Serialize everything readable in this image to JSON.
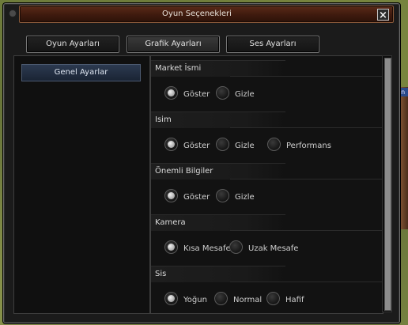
{
  "window": {
    "title": "Oyun Seçenekleri",
    "close_icon": "×"
  },
  "tabs": [
    {
      "label": "Oyun Ayarları",
      "active": false
    },
    {
      "label": "Grafik Ayarları",
      "active": true
    },
    {
      "label": "Ses Ayarları",
      "active": false
    }
  ],
  "sidebar": {
    "items": [
      {
        "label": "Genel Ayarlar",
        "selected": true
      }
    ]
  },
  "sections": [
    {
      "title": "Market İsmi",
      "options": [
        {
          "label": "Göster",
          "selected": true
        },
        {
          "label": "Gizle",
          "selected": false
        }
      ]
    },
    {
      "title": "Isim",
      "options": [
        {
          "label": "Göster",
          "selected": true
        },
        {
          "label": "Gizle",
          "selected": false
        },
        {
          "label": "Performans",
          "selected": false
        }
      ]
    },
    {
      "title": "Önemli Bilgiler",
      "options": [
        {
          "label": "Göster",
          "selected": true
        },
        {
          "label": "Gizle",
          "selected": false
        }
      ]
    },
    {
      "title": "Kamera",
      "options": [
        {
          "label": "Kısa Mesafe",
          "selected": true
        },
        {
          "label": "Uzak Mesafe",
          "selected": false
        }
      ]
    },
    {
      "title": "Sis",
      "options": [
        {
          "label": "Yoğun",
          "selected": true
        },
        {
          "label": "Normal",
          "selected": false
        },
        {
          "label": "Hafif",
          "selected": false
        }
      ]
    }
  ],
  "background": {
    "character_tag": "Den"
  },
  "colors": {
    "titlebar": "#4a2010",
    "selected_side_item": "#26324a"
  }
}
